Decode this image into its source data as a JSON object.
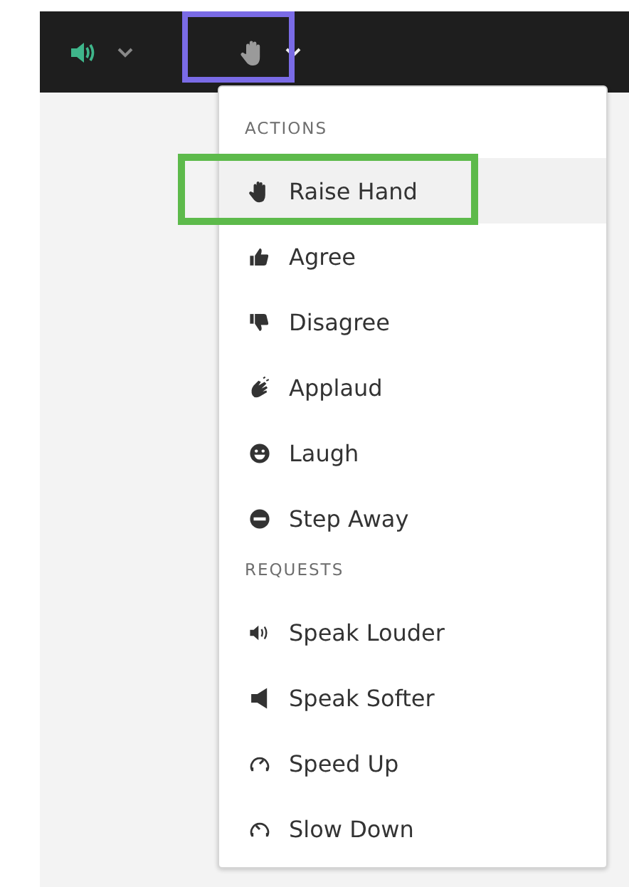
{
  "toolbar": {
    "buttons": [
      {
        "highlighted": false
      },
      {
        "highlighted": true
      }
    ]
  },
  "menu": {
    "sections": [
      {
        "heading": "ACTIONS",
        "items": [
          {
            "label": "Raise Hand",
            "selected": true,
            "highlighted": true
          },
          {
            "label": "Agree",
            "selected": false,
            "highlighted": false
          },
          {
            "label": "Disagree",
            "selected": false,
            "highlighted": false
          },
          {
            "label": "Applaud",
            "selected": false,
            "highlighted": false
          },
          {
            "label": "Laugh",
            "selected": false,
            "highlighted": false
          },
          {
            "label": "Step Away",
            "selected": false,
            "highlighted": false
          }
        ]
      },
      {
        "heading": "REQUESTS",
        "items": [
          {
            "label": "Speak Louder",
            "selected": false,
            "highlighted": false
          },
          {
            "label": "Speak Softer",
            "selected": false,
            "highlighted": false
          },
          {
            "label": "Speed Up",
            "selected": false,
            "highlighted": false
          },
          {
            "label": "Slow Down",
            "selected": false,
            "highlighted": false
          }
        ]
      }
    ]
  }
}
